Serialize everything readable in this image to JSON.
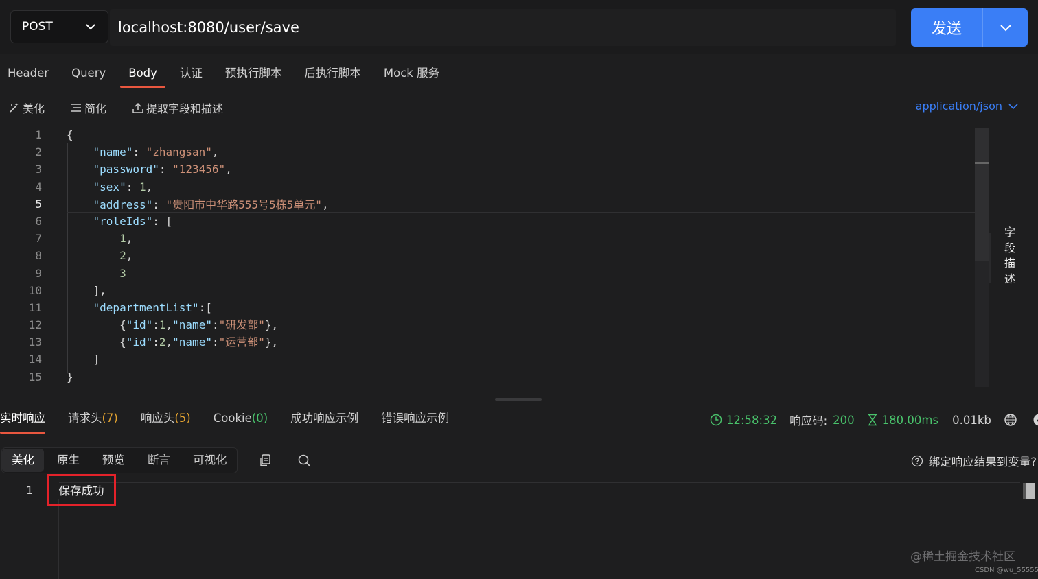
{
  "request": {
    "method": "POST",
    "url": "localhost:8080/user/save",
    "send_label": "发送"
  },
  "tabs": [
    {
      "label": "Header"
    },
    {
      "label": "Query"
    },
    {
      "label": "Body"
    },
    {
      "label": "认证"
    },
    {
      "label": "预执行脚本"
    },
    {
      "label": "后执行脚本"
    },
    {
      "label": "Mock 服务"
    }
  ],
  "body_toolbar": {
    "beautify": "美化",
    "simplify": "简化",
    "extract": "提取字段和描述",
    "content_type": "application/json"
  },
  "editor": {
    "line_numbers": [
      "1",
      "2",
      "3",
      "4",
      "5",
      "6",
      "7",
      "8",
      "9",
      "10",
      "11",
      "12",
      "13",
      "14",
      "15"
    ],
    "current_line": "5"
  },
  "side_label": "字段描述",
  "response_tabs": {
    "realtime": "实时响应",
    "req_headers": "请求头",
    "req_headers_count": "(7)",
    "resp_headers": "响应头",
    "resp_headers_count": "(5)",
    "cookie": "Cookie",
    "cookie_count": "(0)",
    "success_example": "成功响应示例",
    "error_example": "错误响应示例"
  },
  "response_info": {
    "time": "12:58:32",
    "code_label": "响应码:",
    "code": "200",
    "duration": "180.00ms",
    "size": "0.01kb"
  },
  "response_view": {
    "beautify": "美化",
    "raw": "原生",
    "preview": "预览",
    "assert": "断言",
    "visualize": "可视化",
    "bind_label": "绑定响应结果到变量?"
  },
  "response_body": {
    "line": "1",
    "text": "保存成功"
  },
  "watermark": "@稀土掘金技术社区",
  "watermark_small": "CSDN @wu_55555",
  "colors": {
    "accent_blue": "#3a7ef6",
    "active_tab": "#e9573f",
    "success_green": "#49c26b",
    "count_orange": "#e0a130",
    "highlight_red": "#e4222a"
  }
}
